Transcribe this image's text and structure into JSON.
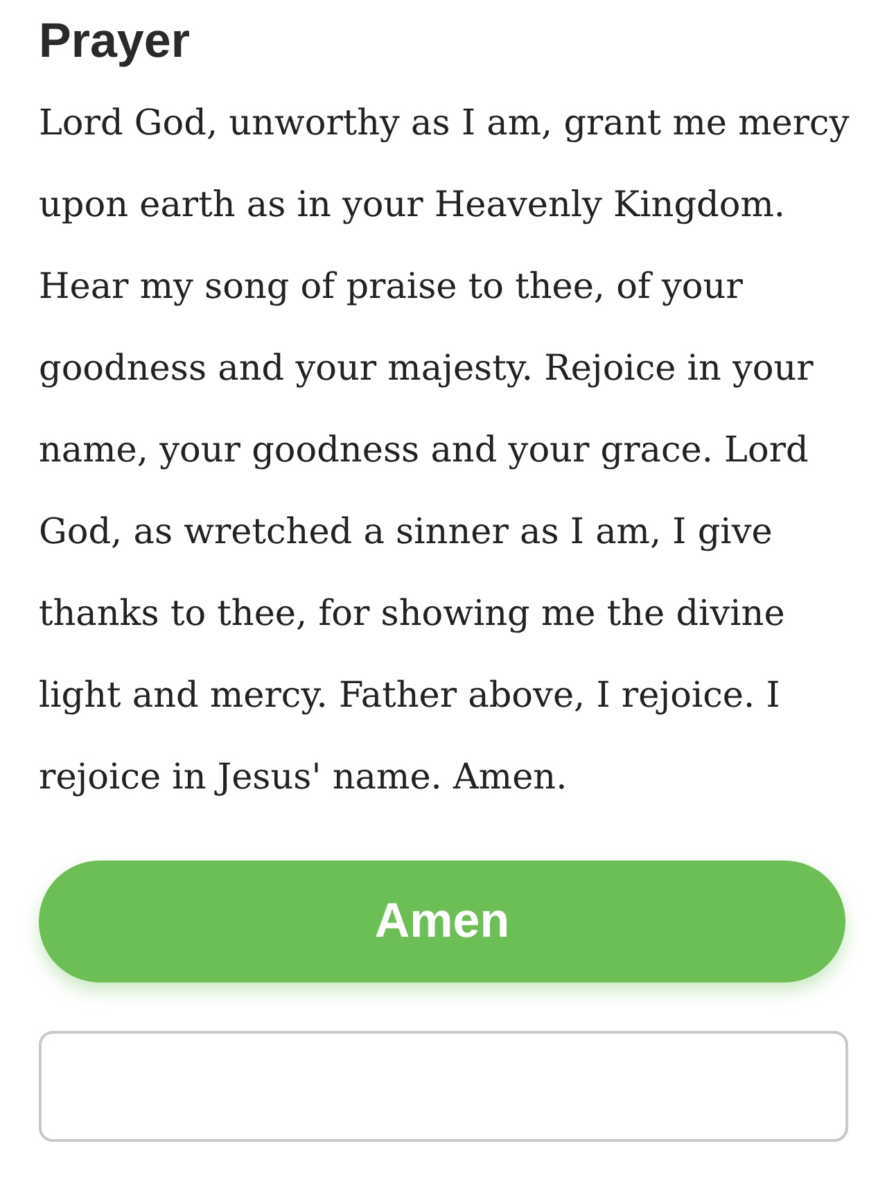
{
  "heading": "Prayer",
  "prayer": "Lord God, unworthy as I am, grant me mercy upon earth as in your Heavenly Kingdom. Hear my song of praise to thee, of your goodness and your majesty. Rejoice in your name, your goodness and your grace. Lord God, as wretched a sinner as I am, I give thanks to thee, for showing me the divine light and mercy. Father above, I rejoice. I rejoice in Jesus' name. Amen.",
  "button": "Amen"
}
